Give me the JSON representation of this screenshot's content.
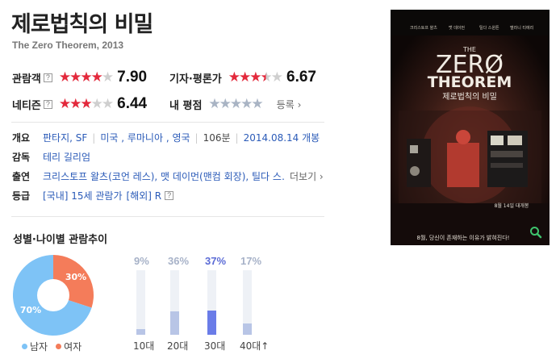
{
  "movie": {
    "title": "제로법칙의 비밀",
    "subtitle": "The Zero Theorem, 2013"
  },
  "ratings": {
    "audience": {
      "label": "관람객",
      "help": "?",
      "stars": 4,
      "score": "7.90"
    },
    "critic": {
      "label": "기자·평론가",
      "stars": 3.5,
      "score": "6.67"
    },
    "netizen": {
      "label": "네티즌",
      "help": "?",
      "stars": 3,
      "score": "6.44"
    },
    "mine": {
      "label": "내 평점",
      "register": "등록",
      "register_arrow": "›"
    }
  },
  "info": {
    "overview": {
      "label": "개요",
      "genre": "판타지, SF",
      "country": "미국 , 루마니아 , 영국",
      "runtime": "106분",
      "release": "2014.08.14 개봉"
    },
    "director": {
      "label": "감독",
      "name": "테리 길리엄"
    },
    "cast": {
      "label": "출연",
      "names": "크리스토프 왈츠(코언 레스), 맷 데이먼(맨컴 회장), 틸다 스…",
      "more": "더보기 ›"
    },
    "grade": {
      "label": "등급",
      "domestic": "[국내] 15세 관람가",
      "overseas": "[해외] R",
      "help": "?"
    }
  },
  "poster": {
    "tagline_top": "THE",
    "title_line1": "ZERØ",
    "title_line2": "THEOREM",
    "korean_title": "제로법칙의 비밀",
    "cast_names": [
      "크리스토프 왈츠",
      "맷 데이먼",
      "틸다 스윈튼",
      "멜라니 티에리"
    ],
    "release_text": "8월 14일 대개봉",
    "bottom_tagline": "8월, 당신이 존재하는 이유가 밝혀진다!",
    "search_icon": "magnifier-icon"
  },
  "gender_age": {
    "title": "성별·나이별 관람추이",
    "gender": [
      {
        "label": "남자",
        "percent": 70,
        "display": "70%",
        "color": "#7ec3f6"
      },
      {
        "label": "여자",
        "percent": 30,
        "display": "30%",
        "color": "#f47c5a"
      }
    ],
    "ages": [
      {
        "label": "10대",
        "percent": 9,
        "display": "9%"
      },
      {
        "label": "20대",
        "percent": 36,
        "display": "36%"
      },
      {
        "label": "30대",
        "percent": 37,
        "display": "37%",
        "highlight": true
      },
      {
        "label": "40대↑",
        "percent": 17,
        "display": "17%"
      }
    ]
  }
}
